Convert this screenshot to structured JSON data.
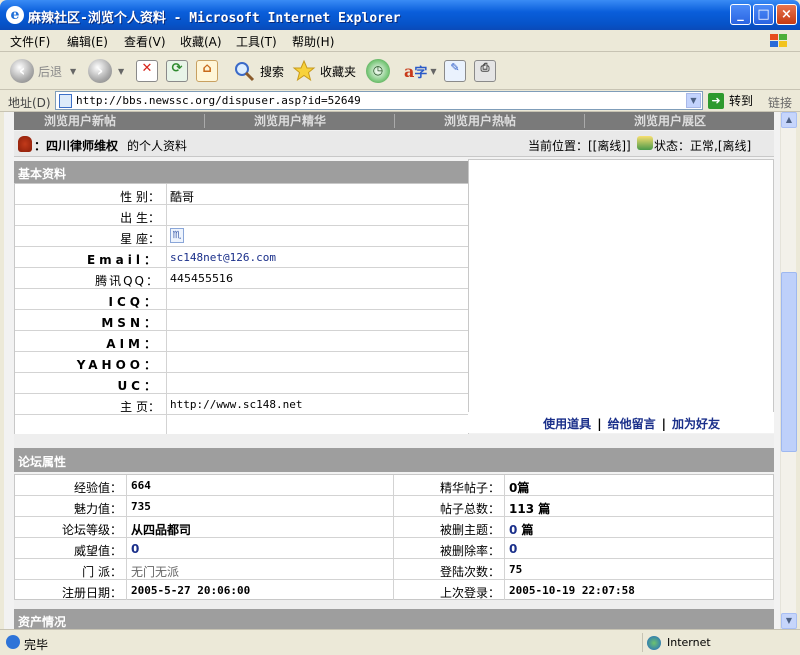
{
  "window": {
    "title": "麻辣社区-浏览个人资料 - Microsoft Internet Explorer"
  },
  "menu": [
    "文件(F)",
    "编辑(E)",
    "查看(V)",
    "收藏(A)",
    "工具(T)",
    "帮助(H)"
  ],
  "toolbar": {
    "back": "后退",
    "search": "搜索",
    "favorites": "收藏夹"
  },
  "address": {
    "label": "地址(D)",
    "url": "http://bbs.newssc.org/dispuser.asp?id=52649",
    "go": "转到",
    "links": "链接"
  },
  "nav_tabs": [
    "浏览用户新帖",
    "浏览用户精华",
    "浏览用户热帖",
    "浏览用户展区"
  ],
  "header": {
    "username": "：四川律师维权",
    "suffix": "的个人资料",
    "location": "当前位置：[[离线]]",
    "status": "状态：正常,[离线]"
  },
  "basic": {
    "title": "基本资料",
    "rows": [
      {
        "label": "性 别：",
        "value": "酷哥"
      },
      {
        "label": "出 生：",
        "value": ""
      },
      {
        "label": "星 座：",
        "value": "♏"
      },
      {
        "label": "Email：",
        "value": "sc148net@126.com"
      },
      {
        "label": "腾讯QQ：",
        "value": "445455516"
      },
      {
        "label": "ICQ：",
        "value": ""
      },
      {
        "label": "MSN：",
        "value": ""
      },
      {
        "label": "AIM：",
        "value": ""
      },
      {
        "label": "YAHOO：",
        "value": ""
      },
      {
        "label": "UC：",
        "value": ""
      },
      {
        "label": "主 页：",
        "value": "http://www.sc148.net"
      }
    ],
    "actions": [
      "使用道具",
      "给他留言",
      "加为好友"
    ]
  },
  "forum": {
    "title": "论坛属性",
    "left": [
      {
        "label": "经验值：",
        "value": "664"
      },
      {
        "label": "魅力值：",
        "value": "735"
      },
      {
        "label": "论坛等级：",
        "value": "从四品都司"
      },
      {
        "label": "威望值：",
        "value": "0"
      },
      {
        "label": "门 派：",
        "value": "无门无派"
      },
      {
        "label": "注册日期：",
        "value": "2005-5-27 20:06:00"
      }
    ],
    "right": [
      {
        "label": "精华帖子：",
        "value": "0篇"
      },
      {
        "label": "帖子总数：",
        "value": "113 篇"
      },
      {
        "label": "被删主题：",
        "value": "0",
        "unit": " 篇"
      },
      {
        "label": "被删除率：",
        "value": "0"
      },
      {
        "label": "登陆次数：",
        "value": "75"
      },
      {
        "label": "上次登录：",
        "value": "2005-10-19 22:07:58"
      }
    ]
  },
  "assets": {
    "title": "资产情况"
  },
  "status": {
    "text": "完毕",
    "zone": "Internet"
  }
}
